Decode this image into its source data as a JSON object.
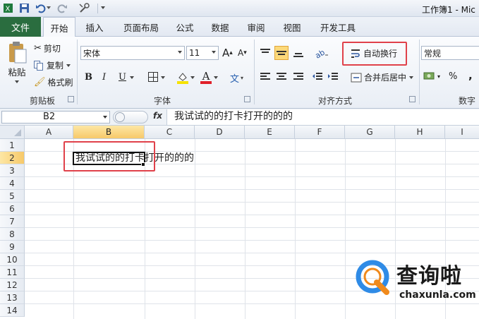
{
  "window": {
    "title": "工作簿1 - Mic"
  },
  "tabs": [
    {
      "label": "文件"
    },
    {
      "label": "开始"
    },
    {
      "label": "插入"
    },
    {
      "label": "页面布局"
    },
    {
      "label": "公式"
    },
    {
      "label": "数据"
    },
    {
      "label": "审阅"
    },
    {
      "label": "视图"
    },
    {
      "label": "开发工具"
    }
  ],
  "clipboard": {
    "paste_label": "粘贴",
    "cut_label": "剪切",
    "copy_label": "复制",
    "format_painter_label": "格式刷",
    "group_label": "剪贴板"
  },
  "font": {
    "font_name": "宋体",
    "font_size": "11",
    "bold": "B",
    "italic": "I",
    "underline": "U",
    "grow_label": "A",
    "shrink_label": "A",
    "font_color_label": "A",
    "phonetic_label": "文",
    "group_label": "字体"
  },
  "alignment": {
    "wrap_text_label": "自动换行",
    "merge_center_label": "合并后居中",
    "group_label": "对齐方式"
  },
  "number": {
    "format_value": "常规",
    "percent": "%",
    "comma": ",",
    "group_label": "数字"
  },
  "formula_bar": {
    "name_box": "B2",
    "fx": "fx",
    "content": "我试试的的打卡打开的的的"
  },
  "grid": {
    "columns": [
      "A",
      "B",
      "C",
      "D",
      "E",
      "F",
      "G",
      "H",
      "I"
    ],
    "rows": [
      "1",
      "2",
      "3",
      "4",
      "5",
      "6",
      "7",
      "8",
      "9",
      "10",
      "11",
      "12",
      "13",
      "14"
    ],
    "cells": {
      "B2": "我试试的的打卡打开的的的"
    }
  },
  "watermark": {
    "text": "查询啦",
    "url": "chaxunla.com"
  },
  "colors": {
    "file_tab": "#2a6d3f",
    "highlight": "#e0414a",
    "selected_header": "#f7c969"
  }
}
